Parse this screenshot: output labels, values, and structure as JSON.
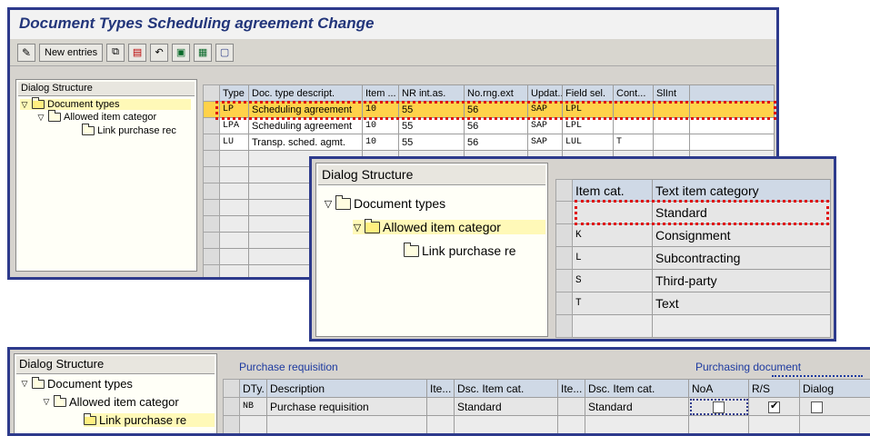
{
  "window1": {
    "title": "Document Types Scheduling agreement Change",
    "toolbar": {
      "new_entries": "New entries"
    },
    "tree": {
      "title": "Dialog Structure",
      "nodes": [
        "Document types",
        "Allowed item categor",
        "Link purchase rec"
      ]
    },
    "table": {
      "headers": [
        "Type",
        "Doc. type descript.",
        "Item ...",
        "NR int.as.",
        "No.rng.ext",
        "Updat...",
        "Field sel.",
        "Cont...",
        "SlInt"
      ],
      "rows": [
        [
          "LP",
          "Scheduling agreement",
          "10",
          "55",
          "56",
          "SAP",
          "LPL",
          "",
          ""
        ],
        [
          "LPA",
          "Scheduling agreement",
          "10",
          "55",
          "56",
          "SAP",
          "LPL",
          "",
          ""
        ],
        [
          "LU",
          "Transp. sched. agmt.",
          "10",
          "55",
          "56",
          "SAP",
          "LUL",
          "T",
          ""
        ]
      ]
    }
  },
  "window2": {
    "tree": {
      "title": "Dialog Structure",
      "nodes": [
        "Document types",
        "Allowed item categor",
        "Link purchase re"
      ]
    },
    "table": {
      "headers": [
        "Item cat.",
        "Text item category"
      ],
      "rows": [
        [
          "",
          "Standard"
        ],
        [
          "K",
          "Consignment"
        ],
        [
          "L",
          "Subcontracting"
        ],
        [
          "S",
          "Third-party"
        ],
        [
          "T",
          "Text"
        ],
        [
          "",
          ""
        ]
      ]
    }
  },
  "window3": {
    "tree": {
      "title": "Dialog Structure",
      "nodes": [
        "Document types",
        "Allowed item categor",
        "Link purchase re"
      ]
    },
    "group_labels": {
      "left": "Purchase requisition",
      "right": "Purchasing document"
    },
    "table": {
      "headers": [
        "DTy.",
        "Description",
        "Ite...",
        "Dsc. Item cat.",
        "Ite...",
        "Dsc. Item cat.",
        "NoA",
        "R/S",
        "Dialog"
      ],
      "row": [
        "NB",
        "Purchase requisition",
        "",
        "Standard",
        "",
        "Standard"
      ],
      "checks": {
        "noa": false,
        "rs": true,
        "dialog": false
      }
    }
  },
  "colors": {
    "frame": "#2d3a8c",
    "title_text": "#22357a",
    "highlight_row": "#ffd24a",
    "callout": "#e01010"
  }
}
